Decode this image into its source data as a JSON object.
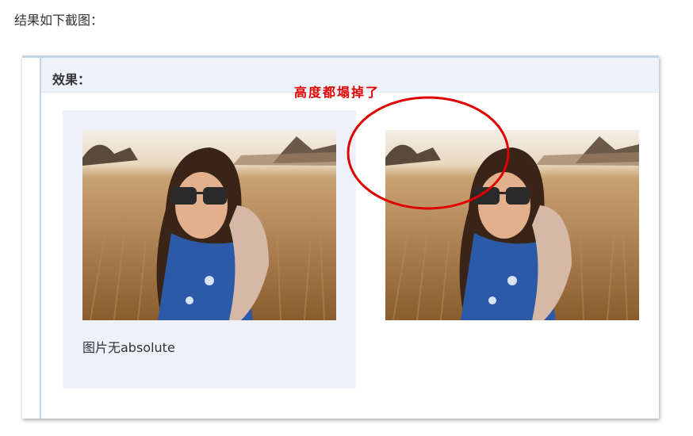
{
  "intro_text": "结果如下截图：",
  "panel": {
    "title": "效果："
  },
  "annotation": {
    "text": "高度都塌掉了",
    "color": "#e00000"
  },
  "left_box": {
    "caption": "图片无absolute"
  },
  "images": [
    {
      "icon": "photo-woman-in-field"
    },
    {
      "icon": "photo-woman-in-field"
    }
  ]
}
